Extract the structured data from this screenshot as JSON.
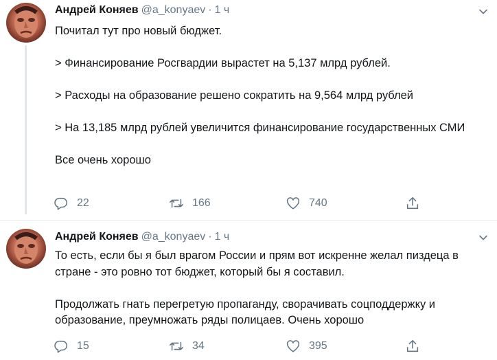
{
  "tweets": [
    {
      "author_name": "Андрей Коняев",
      "handle": "@a_konyaev",
      "separator": "·",
      "time": "1 ч",
      "paragraphs": [
        "Почитал тут про новый бюджет.",
        "",
        "> Финансирование Росгвардии вырастет на 5,137 млрд рублей.",
        "",
        "> Расходы на образование решено сократить на 9,564 млрд рублей",
        "",
        "> На 13,185 млрд рублей увеличится финансирование государственных СМИ",
        "",
        "Все очень хорошо"
      ],
      "replies": "22",
      "retweets": "166",
      "likes": "740"
    },
    {
      "author_name": "Андрей Коняев",
      "handle": "@a_konyaev",
      "separator": "·",
      "time": "1 ч",
      "paragraphs": [
        "То есть, если бы я был врагом России и прям вот искренне желал пиздеца в стране - это ровно тот бюджет, который бы я составил.",
        "",
        "Продолжать гнать перегретую пропаганду, сворачивать соцподдержку и образование, преумножать ряды полицаев. Очень хорошо"
      ],
      "replies": "15",
      "retweets": "34",
      "likes": "395"
    }
  ],
  "colors": {
    "text": "#14171a",
    "secondary": "#657786",
    "divider": "#e6ecf0",
    "thread_line": "#e1e8ed"
  },
  "icons": {
    "reply": "reply-icon",
    "retweet": "retweet-icon",
    "like": "heart-icon",
    "share": "share-icon",
    "menu": "chevron-down-icon"
  }
}
